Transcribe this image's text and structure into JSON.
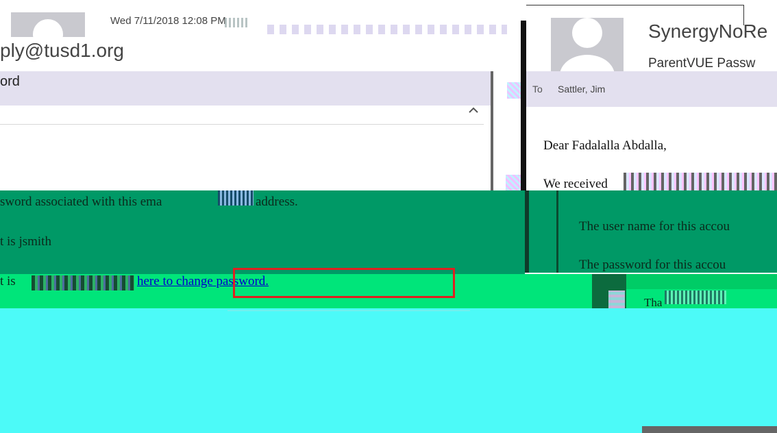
{
  "left_email": {
    "timestamp": "Wed 7/11/2018 12:08 PM",
    "sender_email_partial": "ply@tusd1.org",
    "subject_partial": "ord",
    "body": {
      "line1": "sword associated with this ema",
      "line1_end": "address.",
      "line2": "t is jsmith",
      "line3_prefix": "t is",
      "link_part1": "here to change",
      "link_part2": "password."
    }
  },
  "right_email": {
    "sender_partial": "SynergyNoRe",
    "subject_partial": "ParentVUE Passw",
    "to_label": "To",
    "to_name": "Sattler, Jim",
    "greeting": "Dear Fadalalla Abdalla,",
    "line1_partial": "We received",
    "line2_partial": "The user name for this accou",
    "line3_partial": "The password for this accou",
    "closing_partial": "Tha"
  },
  "colors": {
    "green_dark": "#009966",
    "green_bright": "#00e57a",
    "cyan": "#4cfaf8",
    "highlight": "#e3e0ef",
    "link": "#0000cc",
    "annotation_box": "#e02020"
  }
}
